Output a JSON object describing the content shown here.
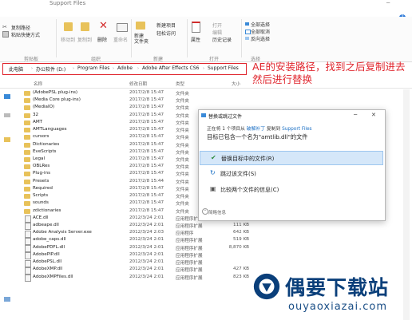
{
  "window": {
    "title": "Support Files"
  },
  "menu": [
    "文件",
    "查看"
  ],
  "ribbon": {
    "copy_path": "复制路径",
    "paste_shortcut": "粘贴快捷方式",
    "clipboard_group": "剪贴板",
    "move_to": "移动到",
    "copy_to": "复制到",
    "delete": "删除",
    "rename": "重命名",
    "organize_group": "组织",
    "new_folder": "新建\n文件夹",
    "new_item": "新建项目",
    "easy_access": "轻松访问",
    "new_group": "新建",
    "properties": "属性",
    "open": "打开",
    "edit": "编辑",
    "history": "历史记录",
    "open_group": "打开",
    "select_all": "全部选择",
    "select_none": "全部取消",
    "invert_selection": "反向选择",
    "select_group": "选择"
  },
  "address": {
    "crumbs": [
      "此电脑",
      "办公软件 (D:)",
      "Program Files",
      "Adobe",
      "Adobe After Effects CS6",
      "Support Files"
    ]
  },
  "annotation": {
    "text": "AE的安装路径，找到之后复制进去 然后进行替换"
  },
  "columns": {
    "name": "名称",
    "date": "修改日期",
    "type": "类型",
    "size": "大小"
  },
  "files": [
    {
      "name": "(AdobePSL plug-ins)",
      "date": "2017/2/8 15:47",
      "type": "文件夹",
      "size": "",
      "kind": "folder"
    },
    {
      "name": "(Media Core plug-ins)",
      "date": "2017/2/8 15:47",
      "type": "文件夹",
      "size": "",
      "kind": "folder"
    },
    {
      "name": "(MediaIO)",
      "date": "2017/2/8 15:47",
      "type": "文件夹",
      "size": "",
      "kind": "folder"
    },
    {
      "name": "32",
      "date": "2017/2/8 15:47",
      "type": "文件夹",
      "size": "",
      "kind": "folder"
    },
    {
      "name": "AMT",
      "date": "2017/2/8 15:47",
      "type": "文件夹",
      "size": "",
      "kind": "folder"
    },
    {
      "name": "AMTLanguages",
      "date": "2017/2/8 15:47",
      "type": "文件夹",
      "size": "",
      "kind": "folder"
    },
    {
      "name": "cursors",
      "date": "2017/2/8 15:47",
      "type": "文件夹",
      "size": "",
      "kind": "folder"
    },
    {
      "name": "Dictionaries",
      "date": "2017/2/8 15:47",
      "type": "文件夹",
      "size": "",
      "kind": "folder"
    },
    {
      "name": "EveScripts",
      "date": "2017/2/8 15:47",
      "type": "文件夹",
      "size": "",
      "kind": "folder"
    },
    {
      "name": "Legal",
      "date": "2017/2/8 15:47",
      "type": "文件夹",
      "size": "",
      "kind": "folder"
    },
    {
      "name": "OBLRes",
      "date": "2017/2/8 15:47",
      "type": "文件夹",
      "size": "",
      "kind": "folder"
    },
    {
      "name": "Plug-ins",
      "date": "2017/2/8 15:47",
      "type": "文件夹",
      "size": "",
      "kind": "folder"
    },
    {
      "name": "Presets",
      "date": "2017/2/8 15:44",
      "type": "文件夹",
      "size": "",
      "kind": "folder"
    },
    {
      "name": "Required",
      "date": "2017/2/8 15:47",
      "type": "文件夹",
      "size": "",
      "kind": "folder"
    },
    {
      "name": "Scripts",
      "date": "2017/2/8 15:47",
      "type": "文件夹",
      "size": "",
      "kind": "folder"
    },
    {
      "name": "sounds",
      "date": "2017/2/8 15:47",
      "type": "文件夹",
      "size": "",
      "kind": "folder"
    },
    {
      "name": "zdictionaries",
      "date": "2017/2/8 15:47",
      "type": "文件夹",
      "size": "",
      "kind": "folder"
    },
    {
      "name": "ACE.dll",
      "date": "2012/3/24 2:01",
      "type": "应用程序扩展",
      "size": "1,801 KB",
      "kind": "file"
    },
    {
      "name": "adbeape.dll",
      "date": "2012/3/24 2:01",
      "type": "应用程序扩展",
      "size": "111 KB",
      "kind": "file"
    },
    {
      "name": "Adobe Analysis Server.exe",
      "date": "2012/3/24 2:03",
      "type": "应用程序",
      "size": "642 KB",
      "kind": "file"
    },
    {
      "name": "adobe_caps.dll",
      "date": "2012/3/24 2:01",
      "type": "应用程序扩展",
      "size": "519 KB",
      "kind": "file"
    },
    {
      "name": "AdobePDFL.dll",
      "date": "2012/3/24 2:01",
      "type": "应用程序扩展",
      "size": "8,870 KB",
      "kind": "file"
    },
    {
      "name": "AdobePIP.dll",
      "date": "2012/3/24 2:01",
      "type": "应用程序扩展",
      "size": "",
      "kind": "file"
    },
    {
      "name": "AdobePSL.dll",
      "date": "2012/3/24 2:01",
      "type": "应用程序扩展",
      "size": "",
      "kind": "file"
    },
    {
      "name": "AdobeXMP.dll",
      "date": "2012/3/24 2:01",
      "type": "应用程序扩展",
      "size": "427 KB",
      "kind": "file"
    },
    {
      "name": "AdobeXMPFiles.dll",
      "date": "2012/3/24 2:01",
      "type": "应用程序扩展",
      "size": "823 KB",
      "kind": "file"
    }
  ],
  "dialog": {
    "title": "替换或跳过文件",
    "line1_pre": "正在将 1 个项目从 ",
    "line1_src": "破解补丁",
    "line1_mid": " 复制到 ",
    "line1_dst": "Support Files",
    "line2": "目标已包含一个名为\"amtlib.dll\"的文件",
    "opt_replace": "替换目标中的文件(R)",
    "opt_skip": "跳过该文件(S)",
    "opt_compare": "比较两个文件的信息(C)",
    "less_info": "简略信息"
  },
  "watermark": {
    "name": "偶要下载站",
    "url": "ouyaoxiazai.com"
  },
  "colors": {
    "accent_red": "#e0262e",
    "link_blue": "#1a6fc4",
    "select_bg": "#d5e7f9",
    "brand_navy": "#0a3f7a"
  }
}
